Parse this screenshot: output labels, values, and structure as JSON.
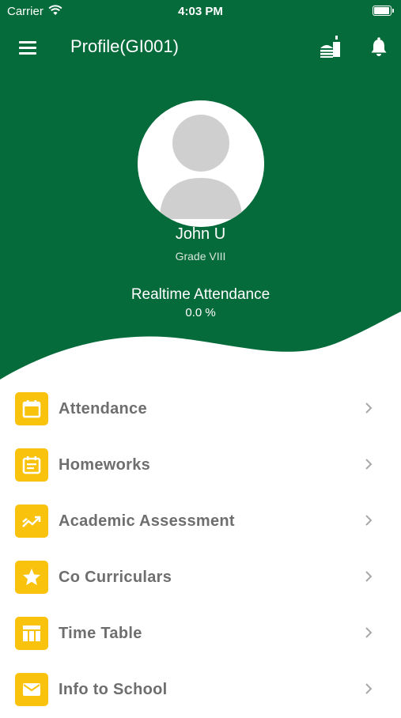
{
  "status_bar": {
    "carrier": "Carrier",
    "time": "4:03 PM"
  },
  "header": {
    "title": "Profile(GI001)"
  },
  "profile": {
    "name": "John U",
    "grade": "Grade VIII",
    "attendance_label": "Realtime Attendance",
    "attendance_value": "0.0 %"
  },
  "menu": {
    "items": [
      {
        "label": "Attendance",
        "icon": "calendar-icon"
      },
      {
        "label": "Homeworks",
        "icon": "homework-icon"
      },
      {
        "label": "Academic Assessment",
        "icon": "trending-icon"
      },
      {
        "label": "Co Curriculars",
        "icon": "star-icon"
      },
      {
        "label": "Time Table",
        "icon": "timetable-icon"
      },
      {
        "label": "Info to School",
        "icon": "mail-icon"
      }
    ]
  },
  "colors": {
    "primary": "#066b3a",
    "accent": "#f9c30d",
    "label": "#6e6e6e"
  }
}
